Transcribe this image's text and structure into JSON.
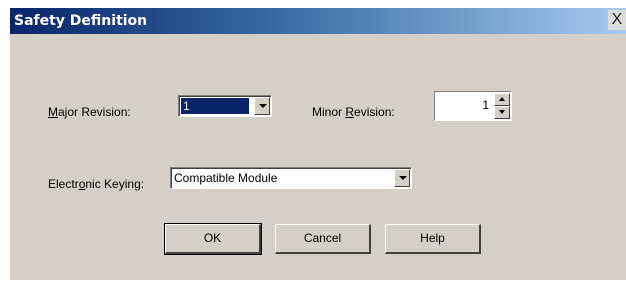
{
  "dialog": {
    "title": "Safety Definition",
    "close_glyph": "X",
    "major_revision": {
      "label_pre": "",
      "label_key": "M",
      "label_post": "ajor Revision:",
      "value": "1"
    },
    "minor_revision": {
      "label_pre": "Minor ",
      "label_key": "R",
      "label_post": "evision:",
      "value": "1"
    },
    "electronic_keying": {
      "label_pre": "Electr",
      "label_key": "o",
      "label_post": "nic Keying:",
      "value": "Compatible Module"
    },
    "buttons": {
      "ok": "OK",
      "cancel": "Cancel",
      "help": "Help"
    }
  }
}
